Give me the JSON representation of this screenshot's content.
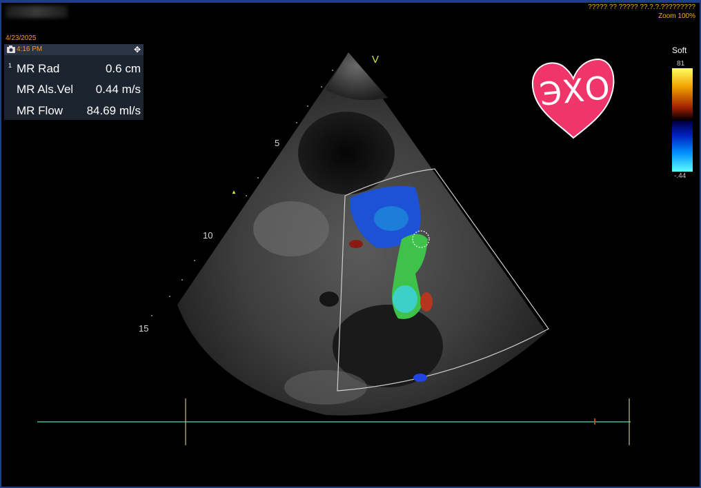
{
  "header": {
    "date": "4/23/2025",
    "time": "4:16 PM",
    "top_right_line1": "????? ?? ????? ??.?.?.?????????",
    "zoom": "Zoom 100%"
  },
  "measurements": [
    {
      "index": "1",
      "label": "MR Rad",
      "value": "0.6 cm"
    },
    {
      "index": "",
      "label": "MR Als.Vel",
      "value": "0.44 m/s"
    },
    {
      "index": "",
      "label": "MR Flow",
      "value": "84.69 ml/s"
    }
  ],
  "colorbar": {
    "label": "Soft",
    "max": "81",
    "min": "-.44"
  },
  "depth_marks": {
    "d5": "5",
    "d10": "10",
    "d15": "15"
  },
  "marker_v": "V",
  "sticker": {
    "text": "ЭХО",
    "color": "#f0356a"
  },
  "colors": {
    "panel": "#1c2430",
    "orange": "#ff9a1a",
    "frame": "#1d3f8a",
    "ecg": "#3fb7a8"
  }
}
